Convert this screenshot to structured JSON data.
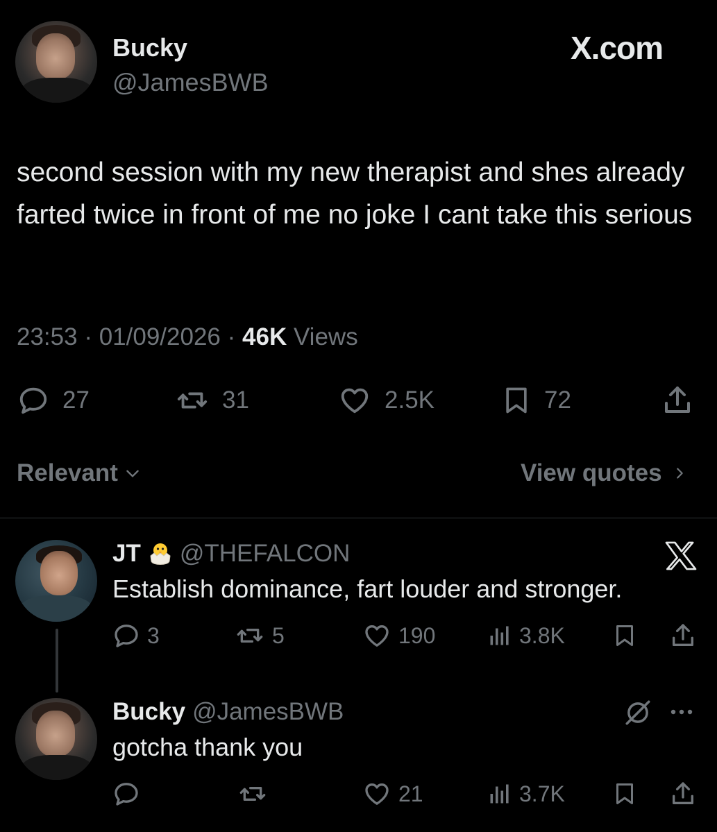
{
  "main_tweet": {
    "author_name": "Bucky",
    "author_handle": "@JamesBWB",
    "watermark": "X.com",
    "text": "second session with my new therapist and shes already farted twice in front of me no joke I cant take this serious",
    "time": "23:53",
    "date": "01/09/2026",
    "views_count": "46K",
    "views_label": "Views",
    "stats": {
      "replies": "27",
      "reposts": "31",
      "likes": "2.5K",
      "bookmarks": "72"
    }
  },
  "sort": {
    "label": "Relevant",
    "view_quotes_label": "View quotes"
  },
  "replies": [
    {
      "author_name": "JT",
      "author_handle": "@THEFALCON",
      "text": "Establish dominance, fart louder and stronger.",
      "stats": {
        "replies": "3",
        "reposts": "5",
        "likes": "190",
        "views": "3.8K"
      }
    },
    {
      "author_name": "Bucky",
      "author_handle": "@JamesBWB",
      "text": "gotcha thank you",
      "stats": {
        "likes": "21",
        "views": "3.7K"
      }
    }
  ],
  "colors": {
    "background": "#000000",
    "text": "#e7e9ea",
    "muted": "#71767b",
    "divider": "#2f3336"
  },
  "icons": [
    "reply-icon",
    "repost-icon",
    "like-icon",
    "bookmark-icon",
    "share-icon",
    "views-icon",
    "x-logo-icon",
    "grok-icon",
    "more-icon",
    "chevron-down-icon",
    "chevron-right-icon",
    "hatching-chick-icon"
  ]
}
